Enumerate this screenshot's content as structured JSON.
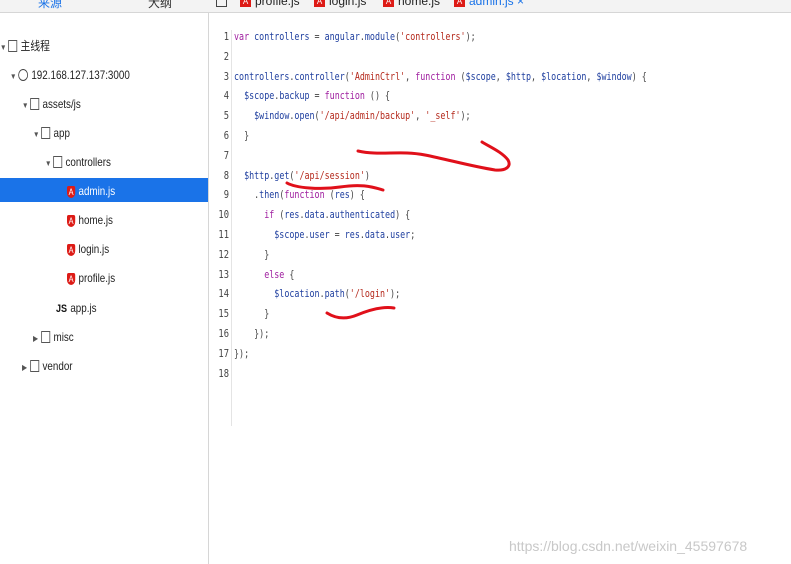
{
  "side_tabs": [
    {
      "label": "来源",
      "active": true
    },
    {
      "label": "大纲",
      "active": false
    }
  ],
  "file_tabs": [
    {
      "label": "profile.js",
      "active": false
    },
    {
      "label": "login.js",
      "active": false
    },
    {
      "label": "home.js",
      "active": false
    },
    {
      "label": "admin.js",
      "active": true,
      "close": "×"
    }
  ],
  "tree": [
    {
      "label": "主线程",
      "icon": "window-icon"
    },
    {
      "label": "192.168.127.137:3000",
      "icon": "globe-icon"
    },
    {
      "label": "assets/js",
      "icon": "folder-icon"
    },
    {
      "label": "app",
      "icon": "folder-icon"
    },
    {
      "label": "controllers",
      "icon": "folder-icon"
    },
    {
      "label": "admin.js",
      "icon": "angular-icon",
      "selected": true
    },
    {
      "label": "home.js",
      "icon": "angular-icon"
    },
    {
      "label": "login.js",
      "icon": "angular-icon"
    },
    {
      "label": "profile.js",
      "icon": "angular-icon"
    },
    {
      "label": "app.js",
      "icon": "js-icon"
    },
    {
      "label": "misc",
      "icon": "folder-icon"
    },
    {
      "label": "vendor",
      "icon": "folder-icon"
    }
  ],
  "code_lines": [
    "var controllers = angular.module('controllers');",
    "",
    "controllers.controller('AdminCtrl', function ($scope, $http, $location, $window) {",
    "  $scope.backup = function () {",
    "    $window.open('/api/admin/backup', '_self');",
    "  }",
    "",
    "  $http.get('/api/session')",
    "    .then(function (res) {",
    "      if (res.data.authenticated) {",
    "        $scope.user = res.data.user;",
    "      }",
    "      else {",
    "        $location.path('/login');",
    "      }",
    "    });",
    "});",
    ""
  ],
  "watermark": "https://blog.csdn.net/weixin_45597678",
  "colors": {
    "selection": "#1a73e8",
    "annotation_ink": "#e0101a",
    "angular_red": "#dd1b16"
  }
}
